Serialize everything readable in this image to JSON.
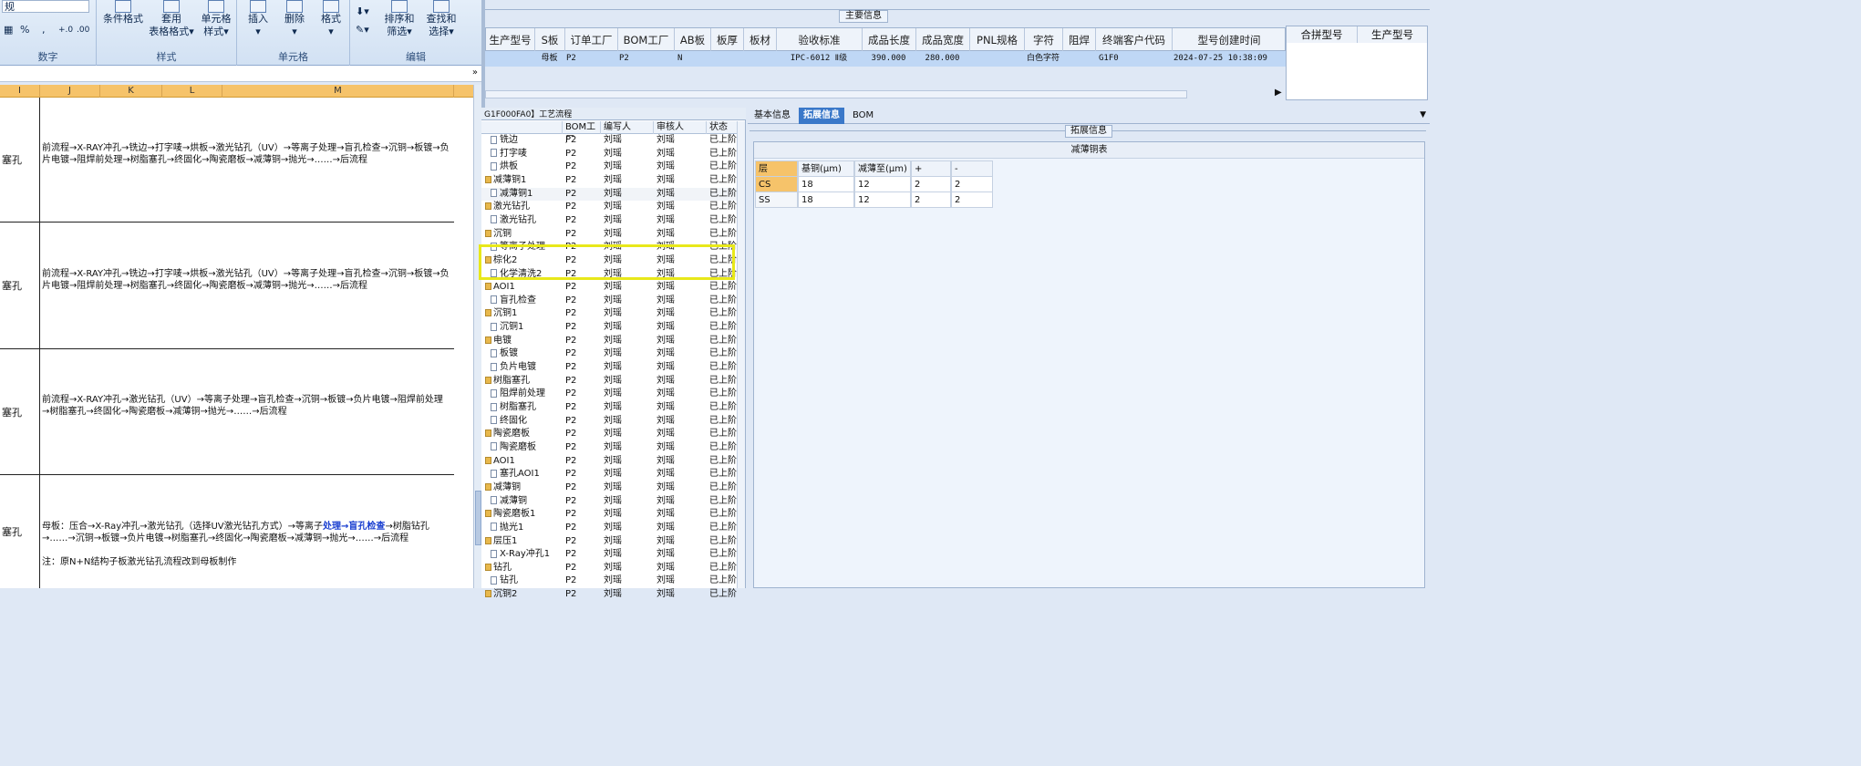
{
  "ribbon": {
    "top_left_text": "规",
    "groups": [
      {
        "label": "数字"
      },
      {
        "label": "样式"
      },
      {
        "label": "单元格"
      },
      {
        "label": "编辑"
      }
    ],
    "buttons": {
      "conditional_format": "条件格式",
      "table_format_1": "套用",
      "table_format_2": "表格格式",
      "cell_style_1": "单元格",
      "cell_style_2": "样式",
      "insert": "插入",
      "delete": "删除",
      "format": "格式",
      "sort_1": "排序和",
      "sort_2": "筛选",
      "find_1": "查找和",
      "find_2": "选择"
    },
    "number_symbols": [
      "%",
      ",",
      "+.0",
      ".00"
    ]
  },
  "sheet": {
    "columns": [
      "I",
      "J",
      "K",
      "L",
      "M"
    ],
    "rows": [
      {
        "a": "塞孔",
        "text": "前流程→X-RAY冲孔→铣边→打字唛→烘板→激光钻孔（UV）→等离子处理→盲孔检查→沉铜→板镀→负片电镀→阻焊前处理→树脂塞孔→终固化→陶瓷磨板→减薄铜→抛光→……→后流程"
      },
      {
        "a": "塞孔",
        "text": "前流程→X-RAY冲孔→铣边→打字唛→烘板→激光钻孔（UV）→等离子处理→盲孔检查→沉铜→板镀→负片电镀→阻焊前处理→树脂塞孔→终固化→陶瓷磨板→减薄铜→抛光→……→后流程"
      },
      {
        "a": "塞孔",
        "text": "前流程→X-RAY冲孔→激光钻孔（UV）→等离子处理→盲孔检查→沉铜→板镀→负片电镀→阻焊前处理→树脂塞孔→终固化→陶瓷磨板→减薄铜→抛光→……→后流程"
      },
      {
        "a": "塞孔",
        "text_pre": "母板：压合→X-Ray冲孔→激光钻孔（选择UV激光钻孔方式）→等离子",
        "text_highlight": "处理→盲孔检查",
        "text_post": "→树脂钻孔→……→沉铜→板镀→负片电镀→树脂塞孔→终固化→陶瓷磨板→减薄铜→抛光→……→后流程",
        "note": "注：原N+N结构子板激光钻孔流程改到母板制作"
      }
    ]
  },
  "main_info": {
    "section_title": "主要信息",
    "headers": [
      "生产型号",
      "S板",
      "订单工厂",
      "BOM工厂",
      "AB板",
      "板厚",
      "板材",
      "验收标准",
      "成品长度",
      "成品宽度",
      "PNL规格",
      "字符",
      "阻焊",
      "终端客户代码",
      "型号创建时间"
    ],
    "row": [
      "",
      "母板",
      "P2",
      "P2",
      "N",
      "",
      "",
      "IPC-6012 Ⅱ级",
      "390.000",
      "280.000",
      "",
      "白色字符",
      "",
      "G1F0",
      "2024-07-25 10:38:09"
    ],
    "merge_headers": [
      "合拼型号",
      "生产型号"
    ]
  },
  "process": {
    "title": "G1F000FA0】工艺流程",
    "headers": [
      "BOM工厂",
      "编写人",
      "审核人",
      "状态"
    ],
    "rows": [
      {
        "name": "铣边",
        "type": "doc",
        "f": "P2",
        "w": "刘瑶",
        "r": "刘瑶",
        "s": "已上阶"
      },
      {
        "name": "打字唛",
        "type": "doc",
        "f": "P2",
        "w": "刘瑶",
        "r": "刘瑶",
        "s": "已上阶"
      },
      {
        "name": "烘板",
        "type": "doc",
        "f": "P2",
        "w": "刘瑶",
        "r": "刘瑶",
        "s": "已上阶"
      },
      {
        "name": "减薄铜1",
        "type": "fold",
        "f": "P2",
        "w": "刘瑶",
        "r": "刘瑶",
        "s": "已上阶"
      },
      {
        "name": "减薄铜1",
        "type": "doc",
        "f": "P2",
        "w": "刘瑶",
        "r": "刘瑶",
        "s": "已上阶"
      },
      {
        "name": "激光钻孔",
        "type": "fold",
        "f": "P2",
        "w": "刘瑶",
        "r": "刘瑶",
        "s": "已上阶"
      },
      {
        "name": "激光钻孔",
        "type": "doc",
        "f": "P2",
        "w": "刘瑶",
        "r": "刘瑶",
        "s": "已上阶"
      },
      {
        "name": "沉铜",
        "type": "fold",
        "f": "P2",
        "w": "刘瑶",
        "r": "刘瑶",
        "s": "已上阶"
      },
      {
        "name": "等离子处理",
        "type": "doc",
        "f": "P2",
        "w": "刘瑶",
        "r": "刘瑶",
        "s": "已上阶"
      },
      {
        "name": "棕化2",
        "type": "fold",
        "f": "P2",
        "w": "刘瑶",
        "r": "刘瑶",
        "s": "已上阶"
      },
      {
        "name": "化学清洗2",
        "type": "doc",
        "f": "P2",
        "w": "刘瑶",
        "r": "刘瑶",
        "s": "已上阶"
      },
      {
        "name": "AOI1",
        "type": "fold",
        "f": "P2",
        "w": "刘瑶",
        "r": "刘瑶",
        "s": "已上阶"
      },
      {
        "name": "盲孔检查",
        "type": "doc",
        "f": "P2",
        "w": "刘瑶",
        "r": "刘瑶",
        "s": "已上阶"
      },
      {
        "name": "沉铜1",
        "type": "fold",
        "f": "P2",
        "w": "刘瑶",
        "r": "刘瑶",
        "s": "已上阶"
      },
      {
        "name": "沉铜1",
        "type": "doc",
        "f": "P2",
        "w": "刘瑶",
        "r": "刘瑶",
        "s": "已上阶"
      },
      {
        "name": "电镀",
        "type": "fold",
        "f": "P2",
        "w": "刘瑶",
        "r": "刘瑶",
        "s": "已上阶"
      },
      {
        "name": "板镀",
        "type": "doc",
        "f": "P2",
        "w": "刘瑶",
        "r": "刘瑶",
        "s": "已上阶"
      },
      {
        "name": "负片电镀",
        "type": "doc",
        "f": "P2",
        "w": "刘瑶",
        "r": "刘瑶",
        "s": "已上阶"
      },
      {
        "name": "树脂塞孔",
        "type": "fold",
        "f": "P2",
        "w": "刘瑶",
        "r": "刘瑶",
        "s": "已上阶"
      },
      {
        "name": "阻焊前处理",
        "type": "doc",
        "f": "P2",
        "w": "刘瑶",
        "r": "刘瑶",
        "s": "已上阶"
      },
      {
        "name": "树脂塞孔",
        "type": "doc",
        "f": "P2",
        "w": "刘瑶",
        "r": "刘瑶",
        "s": "已上阶"
      },
      {
        "name": "终固化",
        "type": "doc",
        "f": "P2",
        "w": "刘瑶",
        "r": "刘瑶",
        "s": "已上阶"
      },
      {
        "name": "陶瓷磨板",
        "type": "fold",
        "f": "P2",
        "w": "刘瑶",
        "r": "刘瑶",
        "s": "已上阶"
      },
      {
        "name": "陶瓷磨板",
        "type": "doc",
        "f": "P2",
        "w": "刘瑶",
        "r": "刘瑶",
        "s": "已上阶"
      },
      {
        "name": "AOI1",
        "type": "fold",
        "f": "P2",
        "w": "刘瑶",
        "r": "刘瑶",
        "s": "已上阶"
      },
      {
        "name": "塞孔AOI1",
        "type": "doc",
        "f": "P2",
        "w": "刘瑶",
        "r": "刘瑶",
        "s": "已上阶"
      },
      {
        "name": "减薄铜",
        "type": "fold",
        "f": "P2",
        "w": "刘瑶",
        "r": "刘瑶",
        "s": "已上阶"
      },
      {
        "name": "减薄铜",
        "type": "doc",
        "f": "P2",
        "w": "刘瑶",
        "r": "刘瑶",
        "s": "已上阶"
      },
      {
        "name": "陶瓷磨板1",
        "type": "fold",
        "f": "P2",
        "w": "刘瑶",
        "r": "刘瑶",
        "s": "已上阶"
      },
      {
        "name": "抛光1",
        "type": "doc",
        "f": "P2",
        "w": "刘瑶",
        "r": "刘瑶",
        "s": "已上阶"
      },
      {
        "name": "层压1",
        "type": "fold",
        "f": "P2",
        "w": "刘瑶",
        "r": "刘瑶",
        "s": "已上阶"
      },
      {
        "name": "X-Ray冲孔1",
        "type": "doc",
        "f": "P2",
        "w": "刘瑶",
        "r": "刘瑶",
        "s": "已上阶"
      },
      {
        "name": "钻孔",
        "type": "fold",
        "f": "P2",
        "w": "刘瑶",
        "r": "刘瑶",
        "s": "已上阶"
      },
      {
        "name": "钻孔",
        "type": "doc",
        "f": "P2",
        "w": "刘瑶",
        "r": "刘瑶",
        "s": "已上阶"
      },
      {
        "name": "沉铜2",
        "type": "fold",
        "f": "P2",
        "w": "刘瑶",
        "r": "刘瑶",
        "s": "已上阶"
      }
    ]
  },
  "right_panel": {
    "tabs": [
      "基本信息",
      "拓展信息",
      "BOM"
    ],
    "active_tab": "拓展信息",
    "section_title": "拓展信息",
    "table_title": "减薄铜表",
    "thk_headers": [
      "层",
      "基铜(μm)",
      "减薄至(μm)",
      "+",
      "-"
    ],
    "thk_rows": [
      [
        "CS",
        "18",
        "12",
        "2",
        "2"
      ],
      [
        "SS",
        "18",
        "12",
        "2",
        "2"
      ]
    ]
  },
  "colors": {
    "highlight_box": "#e8e81a",
    "active_tab": "#3a78c9",
    "header_orange": "#f6c36a"
  }
}
